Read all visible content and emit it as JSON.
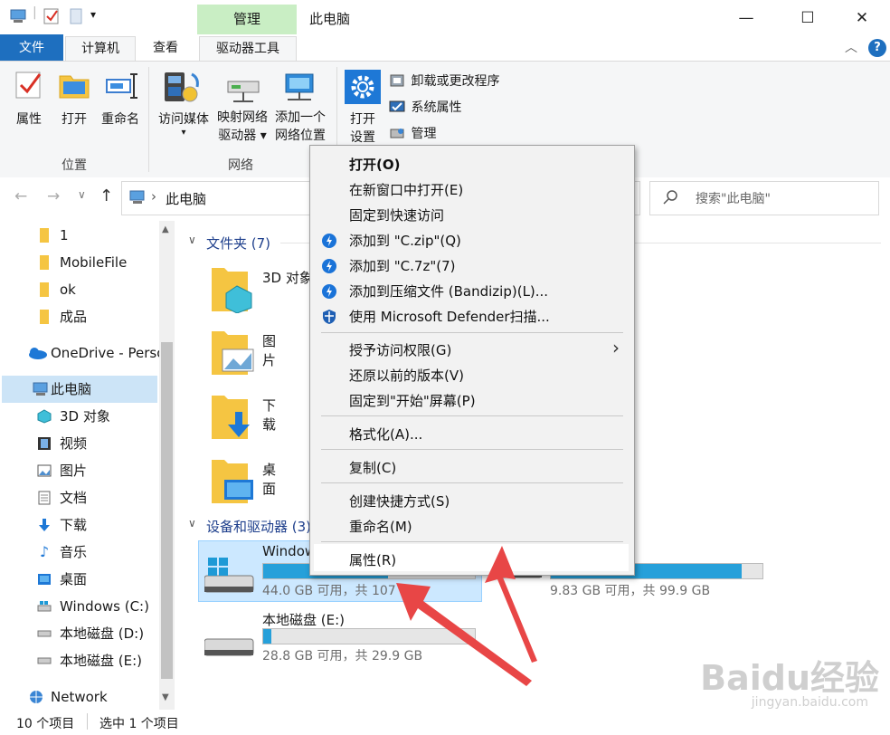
{
  "window": {
    "title": "此电脑",
    "context_tab": "管理",
    "minimize": "—",
    "maximize": "☐",
    "close": "✕"
  },
  "qat": {
    "dropdown": "▾",
    "sep": "|"
  },
  "tabs": [
    {
      "label": "文件"
    },
    {
      "label": "计算机"
    },
    {
      "label": "查看"
    },
    {
      "label": "驱动器工具"
    }
  ],
  "tabrow_icons": {
    "collapse": "︿",
    "help": "?"
  },
  "ribbon": {
    "location_group": {
      "label": "位置",
      "buttons": [
        {
          "label": "属性"
        },
        {
          "label": "打开"
        },
        {
          "label": "重命名"
        }
      ]
    },
    "network_group": {
      "label": "网络",
      "buttons": [
        {
          "label": "访问媒体",
          "dropdown": "▾"
        },
        {
          "label_line1": "映射网络",
          "label_line2": "驱动器 ▾"
        },
        {
          "label_line1": "添加一个",
          "label_line2": "网络位置"
        }
      ]
    },
    "system_group": {
      "open_settings_line1": "打开",
      "open_settings_line2": "设置",
      "items": [
        {
          "label": "卸载或更改程序"
        },
        {
          "label": "系统属性"
        },
        {
          "label": "管理"
        }
      ]
    }
  },
  "address": {
    "back": "←",
    "forward": "→",
    "history": "∨",
    "up": "↑",
    "chevron": "›",
    "path": "此电脑",
    "search_placeholder": "搜索\"此电脑\""
  },
  "nav": {
    "items": [
      {
        "label": "1",
        "icon": "folder-icon"
      },
      {
        "label": "MobileFile",
        "icon": "folder-icon"
      },
      {
        "label": "ok",
        "icon": "folder-icon"
      },
      {
        "label": "成品",
        "icon": "folder-icon"
      },
      {
        "label": "OneDrive - Perso",
        "icon": "cloud-icon"
      },
      {
        "label": "此电脑",
        "icon": "computer-icon"
      },
      {
        "label": "3D 对象",
        "icon": "cube-icon"
      },
      {
        "label": "视频",
        "icon": "film-icon"
      },
      {
        "label": "图片",
        "icon": "picture-icon"
      },
      {
        "label": "文档",
        "icon": "document-icon"
      },
      {
        "label": "下载",
        "icon": "download-icon"
      },
      {
        "label": "音乐",
        "icon": "music-icon"
      },
      {
        "label": "桌面",
        "icon": "desktop-icon"
      },
      {
        "label": "Windows (C:)",
        "icon": "windows-drive-icon"
      },
      {
        "label": "本地磁盘 (D:)",
        "icon": "drive-icon"
      },
      {
        "label": "本地磁盘 (E:)",
        "icon": "drive-icon"
      },
      {
        "label": "Network",
        "icon": "network-icon"
      }
    ],
    "scroll_up": "▲",
    "scroll_down": "▼"
  },
  "content": {
    "folders_header": "文件夹 (7)",
    "folders": [
      {
        "label": "3D 对象"
      },
      {
        "label": "图片"
      },
      {
        "label": "下载"
      },
      {
        "label": "桌面"
      }
    ],
    "drives_header": "设备和驱动器 (3)",
    "drives": [
      {
        "name": "Windows (C:)",
        "visible_name": "Window",
        "used_fraction": 0.59,
        "free": "44.0 GB 可用，共 107 GB"
      },
      {
        "name": "本地磁盘 (D:)",
        "used_fraction": 0.9,
        "free": "9.83 GB 可用，共 99.9 GB"
      },
      {
        "name": "本地磁盘 (E:)",
        "used_fraction": 0.04,
        "free": "28.8 GB 可用，共 29.9 GB"
      }
    ],
    "collapse_glyph": "∨"
  },
  "context_menu": {
    "items": [
      {
        "label": "打开(O)",
        "bold": true
      },
      {
        "label": "在新窗口中打开(E)"
      },
      {
        "label": "固定到快速访问"
      },
      {
        "label": "添加到 \"C.zip\"(Q)",
        "icon": "bandizip-icon"
      },
      {
        "label": "添加到 \"C.7z\"(7)",
        "icon": "bandizip-icon"
      },
      {
        "label": "添加到压缩文件 (Bandizip)(L)...",
        "icon": "bandizip-icon"
      },
      {
        "label": "使用 Microsoft Defender扫描...",
        "icon": "defender-shield-icon"
      },
      {
        "label": "授予访问权限(G)",
        "submenu": "›"
      },
      {
        "label": "还原以前的版本(V)"
      },
      {
        "label": "固定到\"开始\"屏幕(P)"
      },
      {
        "label": "格式化(A)..."
      },
      {
        "label": "复制(C)"
      },
      {
        "label": "创建快捷方式(S)"
      },
      {
        "label": "重命名(M)"
      },
      {
        "label": "属性(R)"
      }
    ]
  },
  "status": {
    "count": "10 个项目",
    "selected": "选中 1 个项目"
  },
  "watermark": {
    "brand": "Baidu经验",
    "url": "jingyan.baidu.com"
  },
  "colors": {
    "accent": "#1e6fbf",
    "context_tab": "#c9eec4",
    "selection": "#cce4f7",
    "drive_fill": "#26a0da",
    "annotation_arrow": "#e84646"
  }
}
